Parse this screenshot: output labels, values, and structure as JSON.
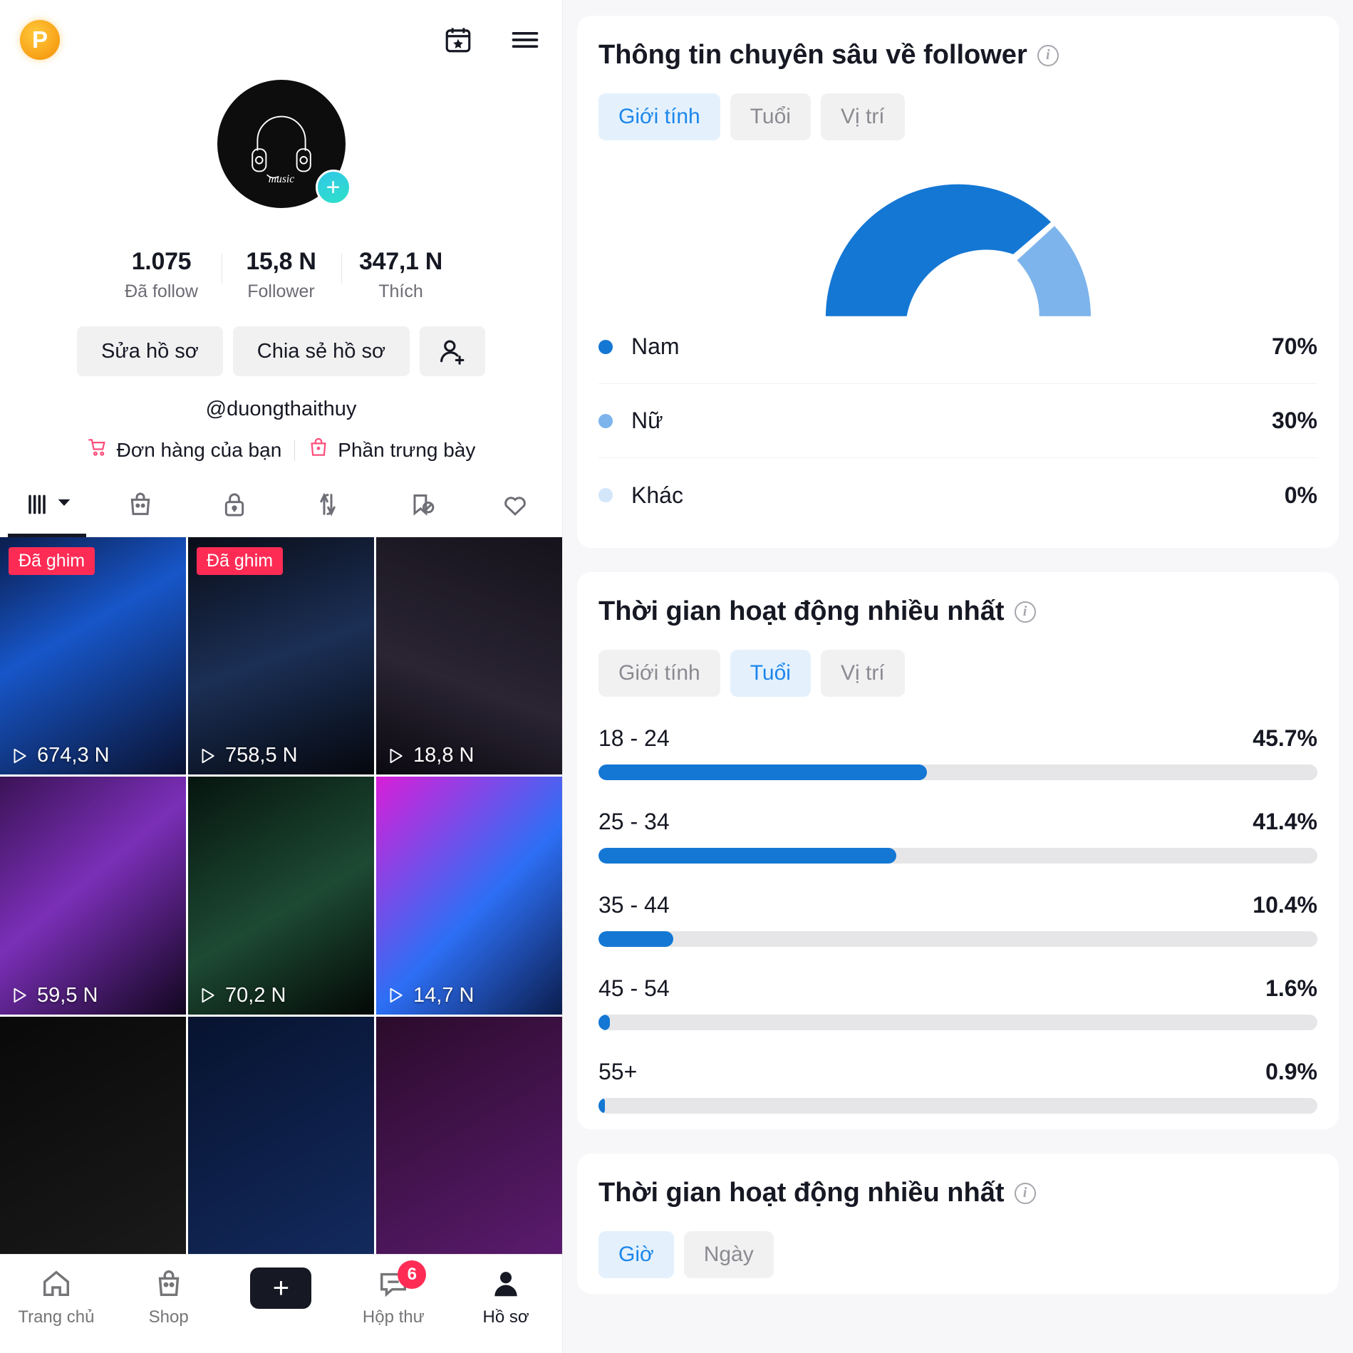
{
  "left_panel": {
    "topbar": {
      "pro_badge": "P",
      "calendar_icon": "calendar-star-icon",
      "menu_icon": "hamburger-menu-icon"
    },
    "avatar": {
      "alt": "music-headphones-avatar",
      "add_label": "+"
    },
    "stats": [
      {
        "num": "1.075",
        "label": "Đã follow"
      },
      {
        "num": "15,8 N",
        "label": "Follower"
      },
      {
        "num": "347,1 N",
        "label": "Thích"
      }
    ],
    "actions": {
      "edit_profile": "Sửa hồ sơ",
      "share_profile": "Chia sẻ hồ sơ",
      "add_friend_icon": "add-user-icon"
    },
    "handle": "@duongthaithuy",
    "shop_links": [
      {
        "label": "Đơn hàng của bạn",
        "icon": "shopping-cart-icon"
      },
      {
        "label": "Phần trưng bày",
        "icon": "shopping-bag-icon"
      }
    ],
    "tabs": [
      {
        "icon": "grid-posts-icon",
        "name": "posts",
        "active": true
      },
      {
        "icon": "shop-bag-icon",
        "name": "shop",
        "active": false
      },
      {
        "icon": "lock-private-icon",
        "name": "private",
        "active": false
      },
      {
        "icon": "repost-arrows-icon",
        "name": "reposts",
        "active": false
      },
      {
        "icon": "bookmark-slash-icon",
        "name": "not-interested",
        "active": false
      },
      {
        "icon": "heart-icon",
        "name": "liked",
        "active": false
      }
    ],
    "videos": [
      {
        "pin": "Đã ghim",
        "views": "674,3 N",
        "bg": "linear-gradient(150deg,#0b1d4d 0%,#1756c9 40%,#0a1230 100%)"
      },
      {
        "pin": "Đã ghim",
        "views": "758,5 N",
        "bg": "linear-gradient(160deg,#0a0d18 0%,#1b2f55 50%,#05070d 100%)"
      },
      {
        "pin": "",
        "views": "18,8 N",
        "bg": "linear-gradient(200deg,#16131c 0%,#2a2433 60%,#0b0910 100%)"
      },
      {
        "pin": "",
        "views": "59,5 N",
        "bg": "linear-gradient(140deg,#3b1356 0%,#7b2fb8 45%,#12061f 100%)"
      },
      {
        "pin": "",
        "views": "70,2 N",
        "bg": "linear-gradient(150deg,#06150f 0%,#1d4a33 55%,#030806 100%)"
      },
      {
        "pin": "",
        "views": "14,7 N",
        "bg": "linear-gradient(135deg,#d81fd8 0%,#2d6ff5 55%,#0b1d4d 100%)"
      },
      {
        "pin": "",
        "views": "",
        "bg": "linear-gradient(150deg,#090909 0%,#1a1a1a 100%)"
      },
      {
        "pin": "",
        "views": "",
        "bg": "linear-gradient(150deg,#07132f 0%,#132a5e 100%)"
      },
      {
        "pin": "",
        "views": "",
        "bg": "linear-gradient(150deg,#2b0b2b 0%,#5a1b6e 100%)"
      }
    ],
    "bottom_nav": [
      {
        "label": "Trang chủ",
        "icon": "home-icon",
        "badge": "",
        "active": false
      },
      {
        "label": "Shop",
        "icon": "shop-bag-icon",
        "badge": "",
        "active": false
      },
      {
        "label": "",
        "icon": "create-plus-icon",
        "badge": "",
        "active": false
      },
      {
        "label": "Hộp thư",
        "icon": "inbox-message-icon",
        "badge": "6",
        "active": false
      },
      {
        "label": "Hồ sơ",
        "icon": "profile-person-icon",
        "badge": "",
        "active": true
      }
    ]
  },
  "right_panel": {
    "follower_insights": {
      "title": "Thông tin chuyên sâu về follower",
      "info_icon": "info-icon",
      "tabs": [
        {
          "label": "Giới tính",
          "active": true
        },
        {
          "label": "Tuổi",
          "active": false
        },
        {
          "label": "Vị trí",
          "active": false
        }
      ]
    },
    "most_active_age": {
      "title": "Thời gian hoạt động nhiều nhất",
      "info_icon": "info-icon",
      "tabs": [
        {
          "label": "Giới tính",
          "active": false
        },
        {
          "label": "Tuổi",
          "active": true
        },
        {
          "label": "Vị trí",
          "active": false
        }
      ]
    },
    "most_active_time": {
      "title": "Thời gian hoạt động nhiều nhất",
      "info_icon": "info-icon",
      "tabs": [
        {
          "label": "Giờ",
          "active": true
        },
        {
          "label": "Ngày",
          "active": false
        }
      ]
    }
  },
  "colors": {
    "primary_blue": "#1477d4",
    "secondary_blue": "#7db4ec",
    "tertiary_blue": "#d3e6fa",
    "accent_pink": "#fe2c55",
    "tab_active_bg": "#e4f1fd",
    "tab_active_text": "#1b86ec",
    "track_grey": "#e6e6e8"
  },
  "chart_data": [
    {
      "type": "pie",
      "title": "Thông tin chuyên sâu về follower",
      "subtitle": "Giới tính",
      "labels": [
        "Nam",
        "Nữ",
        "Khác"
      ],
      "values": [
        70,
        30,
        0
      ],
      "display_values": [
        "70%",
        "30%",
        "0%"
      ],
      "colors": [
        "#1477d4",
        "#7db4ec",
        "#d3e6fa"
      ],
      "legend": "bottom",
      "variant": "half-donut"
    },
    {
      "type": "bar",
      "orientation": "horizontal",
      "title": "Thời gian hoạt động nhiều nhất",
      "subtitle": "Tuổi",
      "categories": [
        "18 - 24",
        "25 - 34",
        "35 - 44",
        "45 - 54",
        "55+"
      ],
      "values": [
        45.7,
        41.4,
        10.4,
        1.6,
        0.9
      ],
      "display_values": [
        "45.7%",
        "41.4%",
        "10.4%",
        "1.6%",
        "0.9%"
      ],
      "xlim": [
        0,
        100
      ],
      "ylabel": "",
      "xlabel": "",
      "grid": false,
      "bar_color": "#1477d4",
      "track_color": "#e6e6e8"
    }
  ]
}
